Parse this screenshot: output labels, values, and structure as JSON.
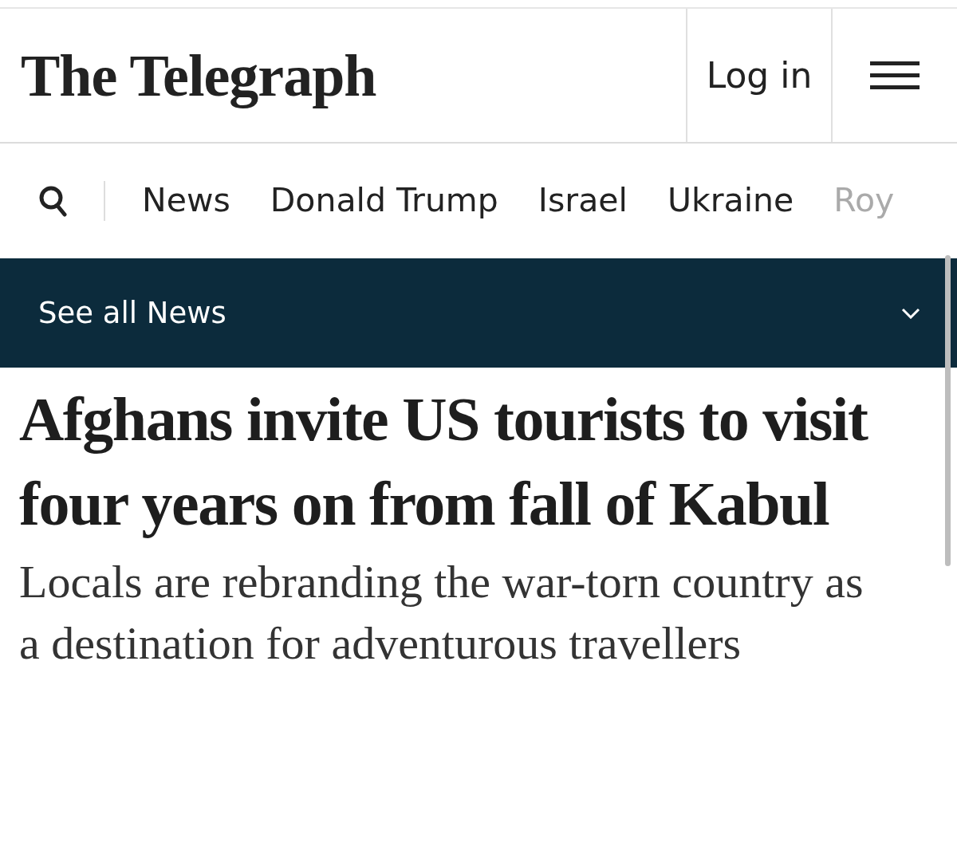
{
  "header": {
    "logo": "The Telegraph",
    "login": "Log in"
  },
  "nav": {
    "items": [
      {
        "label": "News",
        "faded": false
      },
      {
        "label": "Donald Trump",
        "faded": false
      },
      {
        "label": "Israel",
        "faded": false
      },
      {
        "label": "Ukraine",
        "faded": false
      },
      {
        "label": "Roy",
        "faded": true
      }
    ]
  },
  "section_bar": {
    "label": "See all News",
    "expanded": false
  },
  "article": {
    "headline": "Afghans invite US tourists to visit four years on from fall of Kabul",
    "standfirst": "Locals are rebranding the war-torn country as a destination for adventurous travellers"
  }
}
